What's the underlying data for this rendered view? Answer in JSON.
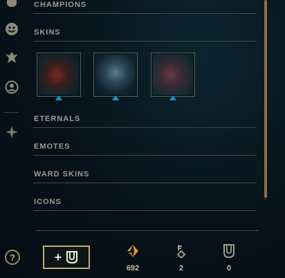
{
  "sidebar": {
    "icons": [
      "helmet-icon",
      "emote-face-icon",
      "ward-icon",
      "profile-icon",
      "eternals-icon"
    ],
    "help_label": "?"
  },
  "sections": {
    "champions": "CHAMPIONS",
    "skins": "SKINS",
    "eternals": "ETERNALS",
    "emotes": "EMOTES",
    "ward_skins": "WARD SKINS",
    "icons": "ICONS"
  },
  "skins": [
    {
      "name": "skin-tile-1",
      "tint": "#5a1e1e"
    },
    {
      "name": "skin-tile-2",
      "tint": "#1a3a4a"
    },
    {
      "name": "skin-tile-3",
      "tint": "#3a1a22"
    }
  ],
  "footer": {
    "add_label": "+",
    "currencies": [
      {
        "icon": "orange-essence-icon",
        "value": "692",
        "color": "#e8902a"
      },
      {
        "icon": "key-fragment-icon",
        "value": "2",
        "color": "#a09b8c"
      },
      {
        "icon": "chest-icon",
        "value": "0",
        "color": "#a09b8c"
      }
    ]
  },
  "colors": {
    "gold": "#c8aa6e",
    "accent_blue": "#1e8fd6",
    "scrollbar": "#8c6f3d"
  }
}
